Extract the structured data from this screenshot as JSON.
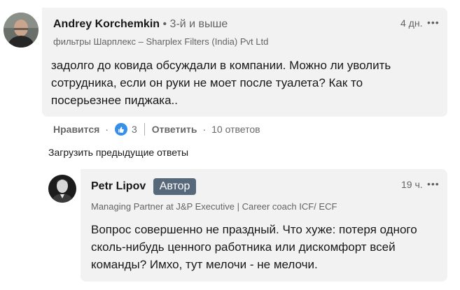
{
  "comment1": {
    "author": "Andrey Korchemkin",
    "degree": "• 3-й и выше",
    "headline": "фильтры Шарплекс – Sharplex Filters (India) Pvt Ltd",
    "time": "4 дн.",
    "more": "•••",
    "text": "задолго до ковида обсуждали в компании. Можно ли уволить сотрудника, если он руки не моет после туалета? Как то посерьезнее пиджака..",
    "like_label": "Нравится",
    "like_count": "3",
    "reply_label": "Ответить",
    "replies_count": "10 ответов"
  },
  "load_previous": "Загрузить предыдущие ответы",
  "comment2": {
    "author": "Petr Lipov",
    "badge": "Автор",
    "headline": "Managing Partner at J&P Executive | Career coach ICF/ ECF",
    "time": "19 ч.",
    "more": "•••",
    "text": "Вопрос совершенно не праздный. Что хуже: потеря одного сколь-нибудь ценного работника или дискомфорт всей команды? Имхо, тут мелочи - не мелочи."
  },
  "colors": {
    "accent": "#378fe9",
    "badge": "#56687a",
    "bubble": "#f2f2f2"
  }
}
